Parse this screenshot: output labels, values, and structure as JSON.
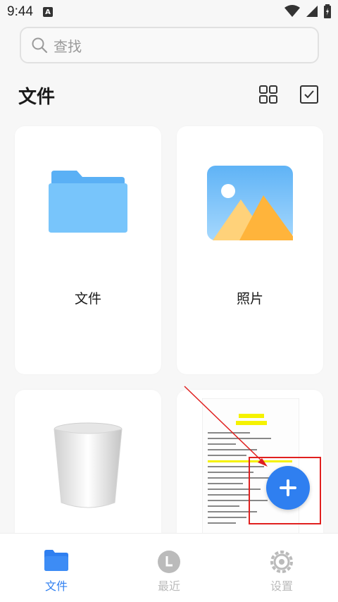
{
  "status_bar": {
    "time": "9:44",
    "a_badge": "A"
  },
  "search": {
    "placeholder": "查找"
  },
  "page": {
    "title": "文件"
  },
  "cards": [
    {
      "label": "文件",
      "icon": "folder-icon"
    },
    {
      "label": "照片",
      "icon": "photo-icon"
    },
    {
      "label": "",
      "icon": "trash-icon"
    },
    {
      "label": "",
      "icon": "document-thumbnail"
    }
  ],
  "fab": {
    "icon": "plus-icon",
    "color": "#2f7ff0"
  },
  "bottom_nav": {
    "items": [
      {
        "label": "文件",
        "active": true,
        "color": "#2f7ff0",
        "icon": "folder-icon"
      },
      {
        "label": "最近",
        "active": false,
        "color": "#bbbbbb",
        "icon": "clock-icon"
      },
      {
        "label": "设置",
        "active": false,
        "color": "#bbbbbb",
        "icon": "gear-icon"
      }
    ]
  },
  "annotation": {
    "color": "#e0201f"
  }
}
